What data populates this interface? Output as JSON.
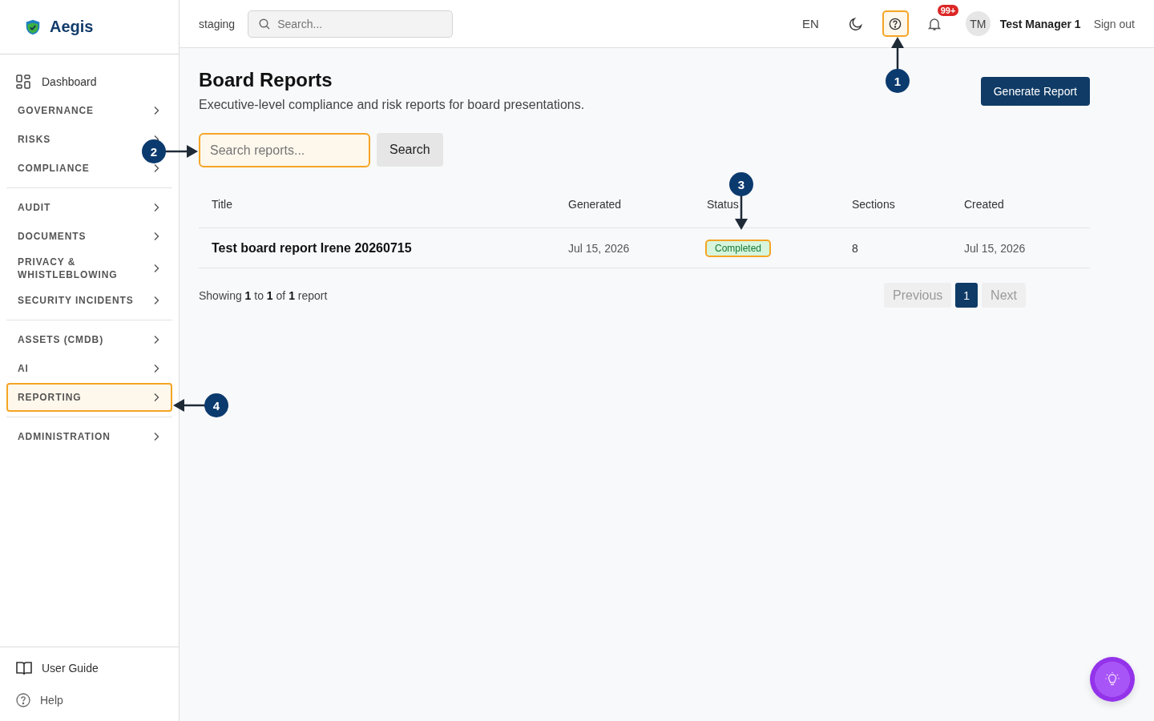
{
  "brand": {
    "name": "Aegis"
  },
  "header": {
    "environment": "staging",
    "search_placeholder": "Search...",
    "language": "EN",
    "help_highlighted": true,
    "notification_count": "99+",
    "avatar_initials": "TM",
    "user_name": "Test Manager 1",
    "sign_out": "Sign out"
  },
  "sidebar": {
    "dashboard": "Dashboard",
    "sections": [
      {
        "items": [
          {
            "label": "GOVERNANCE",
            "highlighted": false
          },
          {
            "label": "RISKS",
            "highlighted": false
          },
          {
            "label": "COMPLIANCE",
            "highlighted": false
          }
        ]
      },
      {
        "items": [
          {
            "label": "AUDIT",
            "highlighted": false
          },
          {
            "label": "DOCUMENTS",
            "highlighted": false
          },
          {
            "label": "PRIVACY & WHISTLEBLOWING",
            "highlighted": false
          },
          {
            "label": "SECURITY INCIDENTS",
            "highlighted": false
          }
        ]
      },
      {
        "items": [
          {
            "label": "ASSETS (CMDB)",
            "highlighted": false
          },
          {
            "label": "AI",
            "highlighted": false
          },
          {
            "label": "REPORTING",
            "highlighted": true
          }
        ]
      },
      {
        "items": [
          {
            "label": "ADMINISTRATION",
            "highlighted": false
          }
        ]
      }
    ],
    "footer": [
      {
        "kind": "book",
        "label": "User Guide"
      },
      {
        "kind": "help",
        "label": "Help"
      }
    ]
  },
  "page": {
    "title": "Board Reports",
    "subtitle": "Executive-level compliance and risk reports for board presentations.",
    "generate_button": "Generate Report",
    "search": {
      "placeholder": "Search reports...",
      "highlighted": true
    },
    "search_button": "Search"
  },
  "table": {
    "columns": [
      "Title",
      "Generated",
      "Status",
      "Sections",
      "Created"
    ],
    "rows": [
      {
        "title": "Test board report Irene 20260715",
        "generated": "Jul 15, 2026",
        "status": {
          "label": "Completed",
          "highlighted": true
        },
        "sections": "8",
        "created": "Jul 15, 2026"
      }
    ]
  },
  "summary": "Showing **1** to **1** of **1** report",
  "pagination": {
    "previous": {
      "label": "Previous",
      "disabled": true
    },
    "pages": [
      {
        "label": "1",
        "selected": true
      }
    ],
    "next": {
      "label": "Next",
      "disabled": true
    }
  },
  "annotations": [
    {
      "label": "1",
      "kind": "up"
    },
    {
      "label": "2",
      "kind": "right"
    },
    {
      "label": "3",
      "kind": "down"
    },
    {
      "label": "4",
      "kind": "left"
    }
  ]
}
